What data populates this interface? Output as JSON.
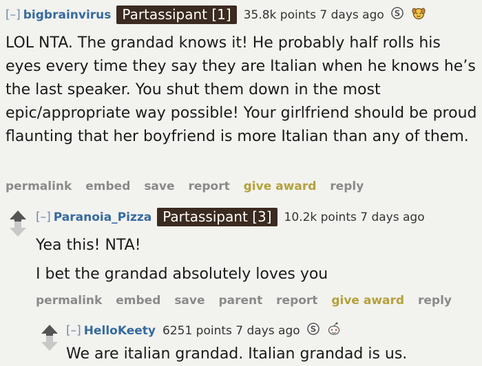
{
  "comments": [
    {
      "collapse": "[–]",
      "user": "bigbrainvirus",
      "flair": "Partassipant [1]",
      "stats": "35.8k points 7 days ago",
      "awards": [
        "silver-s-award-icon",
        "wholesome-dog-award-icon"
      ],
      "body": "LOL NTA. The grandad knows it! He probably half rolls his eyes every time they say they are Italian when he knows he’s the last speaker. You shut them down in the most epic/appropriate way possible! Your girlfriend should be proud flaunting that her boyfriend is more Italian than any of them.",
      "actions": [
        "permalink",
        "embed",
        "save",
        "report",
        "give award",
        "reply"
      ]
    },
    {
      "collapse": "[–]",
      "user": "Paranoia_Pizza",
      "flair": "Partassipant [3]",
      "stats": "10.2k points 7 days ago",
      "body_lines": [
        "Yea this! NTA!",
        "I bet the grandad absolutely loves you"
      ],
      "actions": [
        "permalink",
        "embed",
        "save",
        "parent",
        "report",
        "give award",
        "reply"
      ]
    },
    {
      "collapse": "[–]",
      "user": "HelloKeety",
      "stats": "6251 points 7 days ago",
      "awards": [
        "silver-s-award-icon",
        "snoo-award-icon"
      ],
      "body": "We are italian grandad. Italian grandad is us."
    }
  ],
  "colors": {
    "background": "#f2f2ef",
    "username": "#356aa0",
    "flair_bg": "#3b2a1f",
    "action": "#8a8a8a",
    "give_award": "#b5a13a",
    "upvote": "#555555",
    "downvote": "#c8c8c8"
  }
}
